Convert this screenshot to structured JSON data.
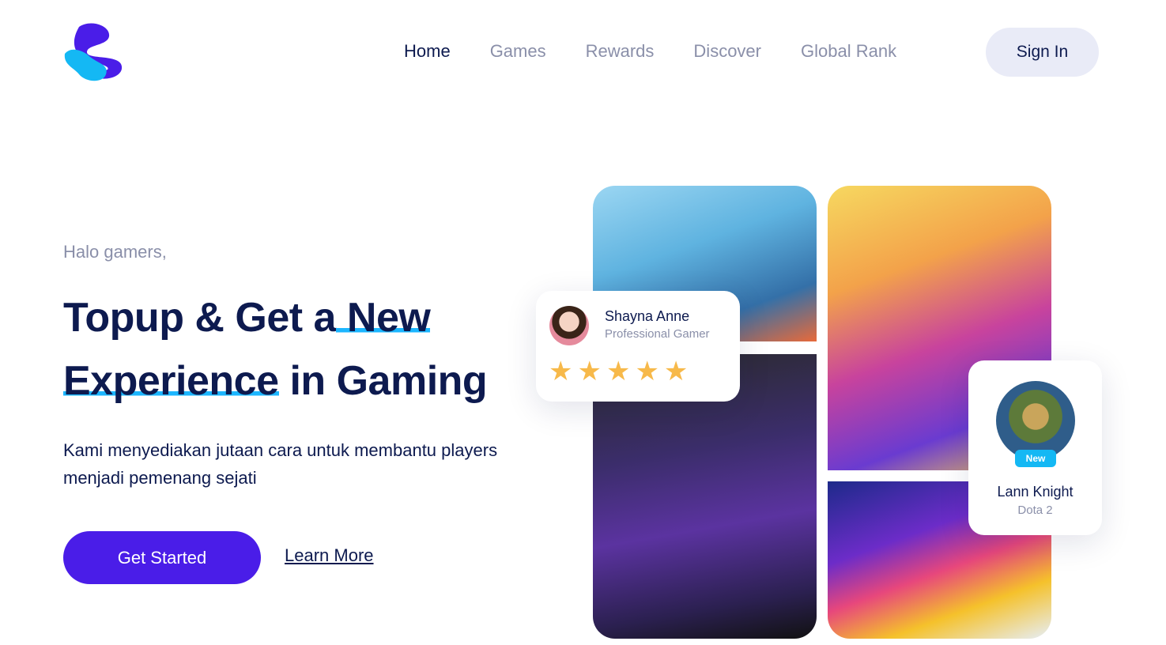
{
  "brand": {
    "logo_icon": "s-wave-logo",
    "colors": {
      "primary": "#4a1de8",
      "accent": "#1cb6ff",
      "text": "#0d1a4f",
      "muted": "#8a8fa9"
    }
  },
  "nav": {
    "items": [
      {
        "label": "Home",
        "active": true
      },
      {
        "label": "Games",
        "active": false
      },
      {
        "label": "Rewards",
        "active": false
      },
      {
        "label": "Discover",
        "active": false
      },
      {
        "label": "Global Rank",
        "active": false
      }
    ],
    "signin_label": "Sign In"
  },
  "hero": {
    "greeting": "Halo gamers,",
    "headline_part1": "Topup & Get a",
    "headline_highlight1": " New",
    "headline_highlight2": "Experience",
    "headline_part2": " in Gaming",
    "description": "Kami menyediakan jutaan cara untuk membantu players menjadi pemenang sejati",
    "cta_primary": "Get Started",
    "cta_secondary": "Learn More"
  },
  "review_card": {
    "name": "Shayna Anne",
    "role": "Professional Gamer",
    "stars": "★★★★★",
    "rating": 5
  },
  "player_card": {
    "badge": "New",
    "name": "Lann Knight",
    "game": "Dota 2"
  }
}
